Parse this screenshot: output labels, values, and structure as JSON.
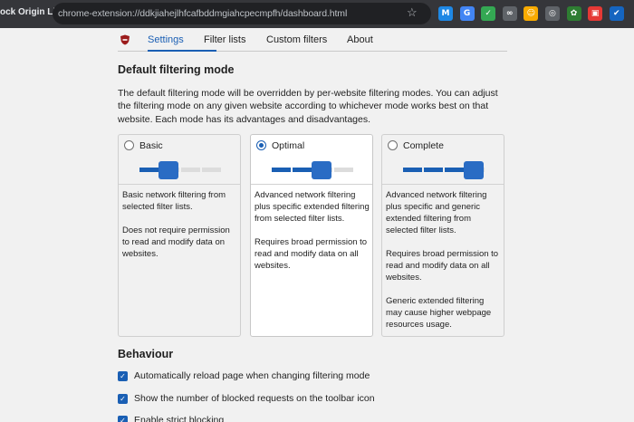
{
  "browser": {
    "tab_title": "ock Origin Lite",
    "url": "chrome-extension://ddkjiahejlhfcafbddmgiahcpecmpfh/dashboard.html",
    "extension_icons": [
      {
        "name": "m-extension-icon",
        "glyph": "M",
        "bg": "#1e88e5"
      },
      {
        "name": "translate-icon",
        "glyph": "G",
        "bg": "#4285f4"
      },
      {
        "name": "check-shield-icon",
        "glyph": "✓",
        "bg": "#34a853"
      },
      {
        "name": "link-icon",
        "glyph": "∞",
        "bg": "#5f6368"
      },
      {
        "name": "badge-icon",
        "glyph": "☺",
        "bg": "#f9ab00"
      },
      {
        "name": "globe-icon",
        "glyph": "◎",
        "bg": "#5f6368"
      },
      {
        "name": "leaf-icon",
        "glyph": "✿",
        "bg": "#2e7d32"
      },
      {
        "name": "picture-icon",
        "glyph": "▣",
        "bg": "#e53935"
      },
      {
        "name": "checkbox-extension-icon",
        "glyph": "✔",
        "bg": "#1565c0"
      }
    ]
  },
  "nav": {
    "tabs": [
      "Settings",
      "Filter lists",
      "Custom filters",
      "About"
    ],
    "active_tab": "Settings"
  },
  "filtering": {
    "heading": "Default filtering mode",
    "description": "The default filtering mode will be overridden by per-website filtering modes. You can adjust the filtering mode on any given website according to whichever mode works best on that website. Each mode has its advantages and disadvantages.",
    "modes": [
      {
        "name": "Basic",
        "selected": false,
        "level": 1,
        "paragraphs": [
          "Basic network filtering from selected filter lists.",
          "Does not require permission to read and modify data on websites."
        ]
      },
      {
        "name": "Optimal",
        "selected": true,
        "level": 2,
        "paragraphs": [
          "Advanced network filtering plus specific extended filtering from selected filter lists.",
          "Requires broad permission to read and modify data on all websites."
        ]
      },
      {
        "name": "Complete",
        "selected": false,
        "level": 3,
        "paragraphs": [
          "Advanced network filtering plus specific and generic extended filtering from selected filter lists.",
          "Requires broad permission to read and modify data on all websites.",
          "Generic extended filtering may cause higher webpage resources usage."
        ]
      }
    ]
  },
  "behaviour": {
    "heading": "Behaviour",
    "options": [
      {
        "label": "Automatically reload page when changing filtering mode",
        "checked": true
      },
      {
        "label": "Show the number of blocked requests on the toolbar icon",
        "checked": true
      },
      {
        "label": "Enable strict blocking",
        "checked": true
      }
    ]
  },
  "colors": {
    "accent": "#1a5fb4",
    "chrome_bg": "#35363a",
    "page_bg": "#f1f1f1"
  }
}
